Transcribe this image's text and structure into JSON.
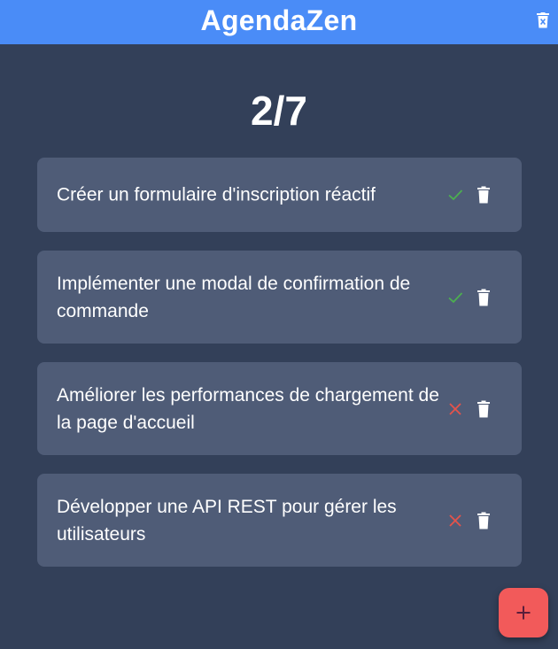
{
  "header": {
    "title": "AgendaZen",
    "clear_all_icon": "trash-x-icon"
  },
  "counter": {
    "done": 2,
    "total": 7,
    "text": "2/7"
  },
  "tasks": [
    {
      "text": "Créer un formulaire d'inscription réactif",
      "completed": true,
      "status_icon": "check-icon"
    },
    {
      "text": "Implémenter une modal de confirmation de commande",
      "completed": true,
      "status_icon": "check-icon"
    },
    {
      "text": "Améliorer les performances de chargement de la page d'accueil",
      "completed": false,
      "status_icon": "x-icon"
    },
    {
      "text": "Développer une API REST pour gérer les utilisateurs",
      "completed": false,
      "status_icon": "x-icon"
    }
  ],
  "fab": {
    "icon": "plus-icon",
    "label": "+"
  },
  "colors": {
    "header": "#4a8cf7",
    "background": "#334059",
    "card": "#4f5c77",
    "check": "#4caf50",
    "cross": "#e5534b",
    "fab": "#f25a5a",
    "fab_icon": "#5b1e3b"
  }
}
